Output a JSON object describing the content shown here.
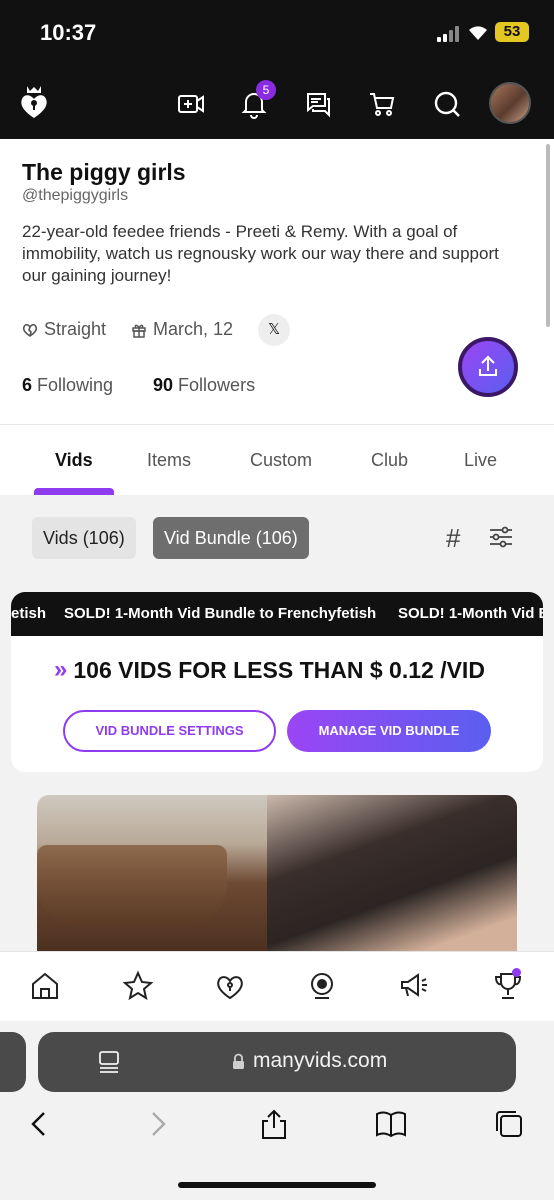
{
  "status_bar": {
    "time": "10:37",
    "battery": "53"
  },
  "header": {
    "notification_count": "5"
  },
  "profile": {
    "name": "The piggy girls",
    "handle": "@thepiggygirls",
    "bio": "22-year-old feedee friends - Preeti & Remy. With a goal of immobility, watch us regnousky work our way there and support our gaining journey!",
    "orientation": "Straight",
    "birthday": "March, 12",
    "x_label": "𝕏",
    "following_count": "6",
    "following_label": "Following",
    "followers_count": "90",
    "followers_label": "Followers"
  },
  "tabs": [
    {
      "label": "Vids",
      "active": true
    },
    {
      "label": "Items"
    },
    {
      "label": "Custom"
    },
    {
      "label": "Club"
    },
    {
      "label": "Live"
    }
  ],
  "filters": {
    "vids": "Vids (106)",
    "bundle": "Vid Bundle (106)"
  },
  "bundle": {
    "ticker_left": "etish",
    "ticker_mid": "SOLD! 1-Month Vid Bundle to Frenchyfetish",
    "ticker_right": "SOLD! 1-Month Vid B",
    "promo": "106 VIDS FOR LESS THAN $ 0.12 /VID",
    "settings_button": "VID BUNDLE SETTINGS",
    "manage_button": "MANAGE VID BUNDLE"
  },
  "browser": {
    "url": "manyvids.com"
  },
  "colors": {
    "accent": "#8f3cf0",
    "dark": "#111111"
  }
}
